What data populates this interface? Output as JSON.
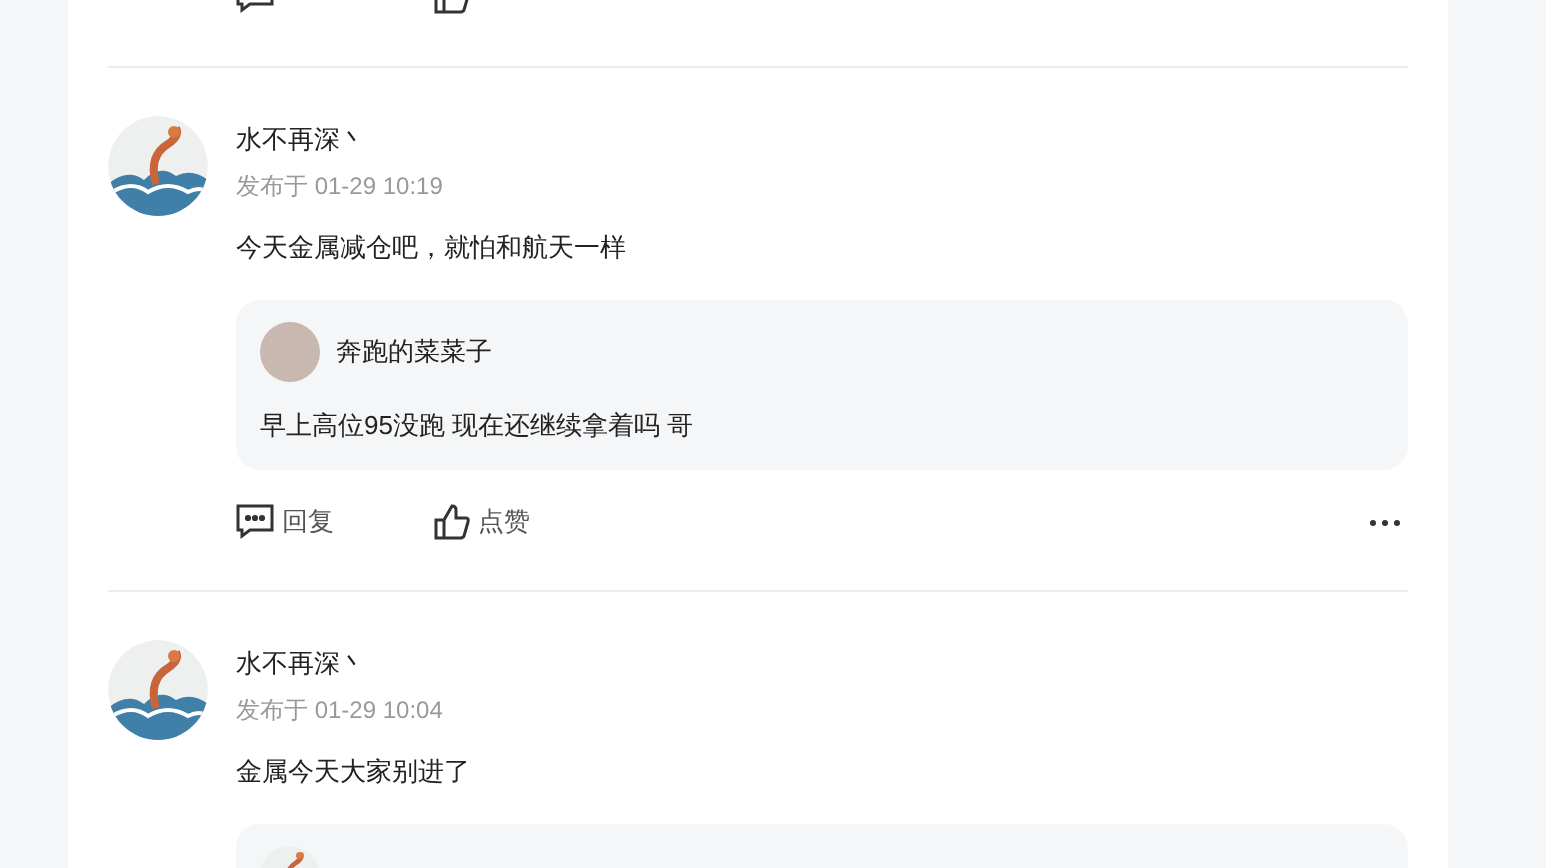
{
  "posts": [
    {
      "author": "水不再深丶",
      "time": "发布于 01-29 10:19",
      "content": "今天金属减仓吧，就怕和航天一样",
      "quote": {
        "author": "奔跑的菜菜子",
        "content": "早上高位95没跑 现在还继续拿着吗 哥"
      },
      "actions": {
        "reply": "回复",
        "like": "点赞"
      }
    },
    {
      "author": "水不再深丶",
      "time": "发布于 01-29 10:04",
      "content": "金属今天大家别进了",
      "quote_cut_off": true
    }
  ]
}
